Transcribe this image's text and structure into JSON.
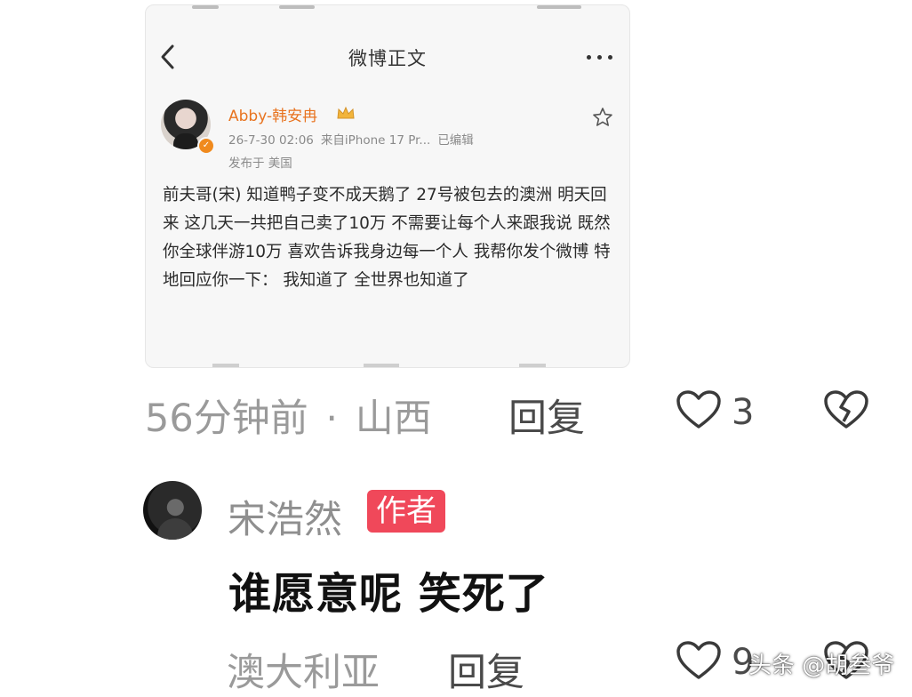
{
  "card": {
    "title": "微博正文",
    "poster_name": "Abby-韩安冉",
    "post_time": "26-7-30 02:06",
    "post_source": "来自iPhone 17 Pr...",
    "post_edited": "已编辑",
    "post_location": "发布于 美国",
    "post_body": "前夫哥(宋) 知道鸭子变不成天鹅了 27号被包去的澳洲 明天回来 这几天一共把自己卖了10万 不需要让每个人来跟我说 既然你全球伴游10万 喜欢告诉我身边每一个人 我帮你发个微博 特地回应你一下： 我知道了 全世界也知道了",
    "icons": [
      "back-icon",
      "more-icon",
      "verified-icon",
      "crown-icon",
      "star-icon"
    ],
    "accent_color": "#e8731f"
  },
  "comment": {
    "time": "56分钟前",
    "separator": "·",
    "location": "山西",
    "reply_label": "回复",
    "like_count": "3"
  },
  "reply": {
    "author": "宋浩然",
    "badge": "作者",
    "badge_color": "#f0485a",
    "text": "谁愿意呢 笑死了",
    "location": "澳大利亚",
    "reply_label": "回复",
    "like_count": "9"
  },
  "watermark": "头条 @胡叁爷"
}
